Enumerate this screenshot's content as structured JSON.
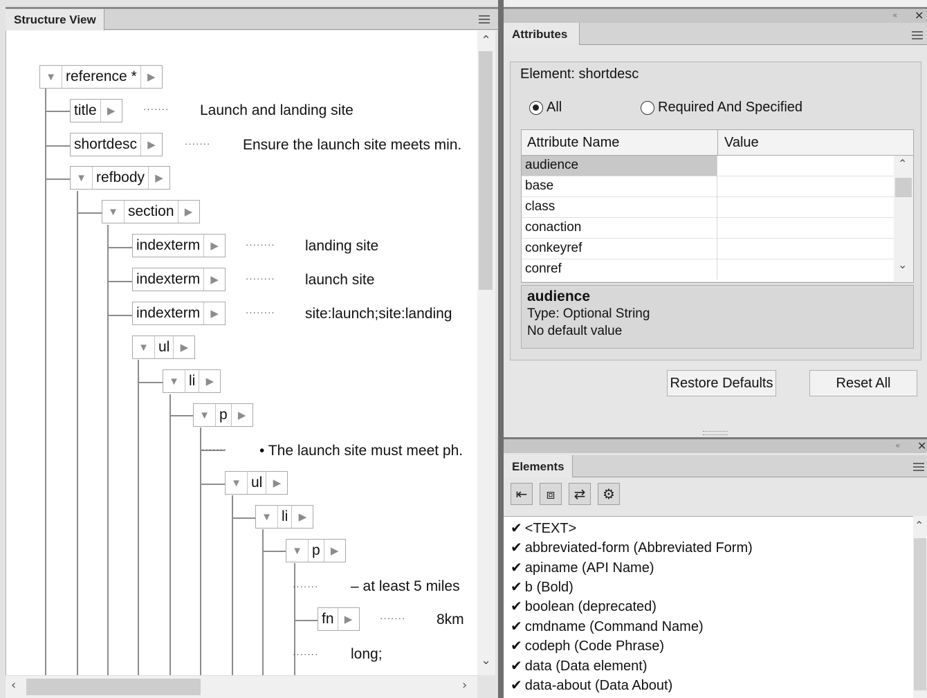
{
  "structure_view": {
    "tab_label": "Structure View",
    "nodes": [
      {
        "name": "reference *",
        "text": ""
      },
      {
        "name": "title",
        "text": "Launch and landing site"
      },
      {
        "name": "shortdesc",
        "text": "Ensure the launch site meets min."
      },
      {
        "name": "refbody",
        "text": ""
      },
      {
        "name": "section",
        "text": ""
      },
      {
        "name": "indexterm",
        "text": "landing site"
      },
      {
        "name": "indexterm",
        "text": "launch site"
      },
      {
        "name": "indexterm",
        "text": "site:launch;site:landing"
      },
      {
        "name": "ul",
        "text": ""
      },
      {
        "name": "li",
        "text": ""
      },
      {
        "name": "p",
        "text": ""
      },
      {
        "name": "",
        "text": "• The launch site must meet ph."
      },
      {
        "name": "ul",
        "text": ""
      },
      {
        "name": "li",
        "text": ""
      },
      {
        "name": "p",
        "text": ""
      },
      {
        "name": "",
        "text": "– at least 5 miles"
      },
      {
        "name": "fn",
        "text": "8km"
      },
      {
        "name": "",
        "text": "long;"
      }
    ],
    "glyphs": {
      "twisty": "▼",
      "expand": "▶",
      "scroll_up": "⌃",
      "scroll_down": "⌄",
      "scroll_left": "‹",
      "scroll_right": "›"
    }
  },
  "attributes": {
    "tab_label": "Attributes",
    "element_label": "Element: shortdesc",
    "radio_all": "All",
    "radio_required": "Required And Specified",
    "radio_selected": "All",
    "col_name": "Attribute Name",
    "col_value": "Value",
    "rows": [
      {
        "name": "audience",
        "value": "",
        "selected": true
      },
      {
        "name": "base",
        "value": ""
      },
      {
        "name": "class",
        "value": ""
      },
      {
        "name": "conaction",
        "value": ""
      },
      {
        "name": "conkeyref",
        "value": ""
      },
      {
        "name": "conref",
        "value": ""
      }
    ],
    "desc_name": "audience",
    "desc_type": "Type: Optional String",
    "desc_default": "No default value",
    "btn_restore": "Restore Defaults",
    "btn_reset": "Reset All"
  },
  "elements": {
    "tab_label": "Elements",
    "tools": [
      "insert-icon",
      "wrap-icon",
      "change-icon",
      "settings-icon"
    ],
    "items": [
      "<TEXT>",
      "abbreviated-form  (Abbreviated Form)",
      "apiname  (API Name)",
      "b  (Bold)",
      "boolean  (deprecated)",
      "cmdname  (Command Name)",
      "codeph  (Code Phrase)",
      "data  (Data element)",
      "data-about  (Data About)"
    ],
    "check_glyph": "✔"
  },
  "colors": {
    "selection": "#c8c8c8",
    "panel_bg": "#e6e6e6",
    "tab_strip": "#d4d4d4"
  }
}
